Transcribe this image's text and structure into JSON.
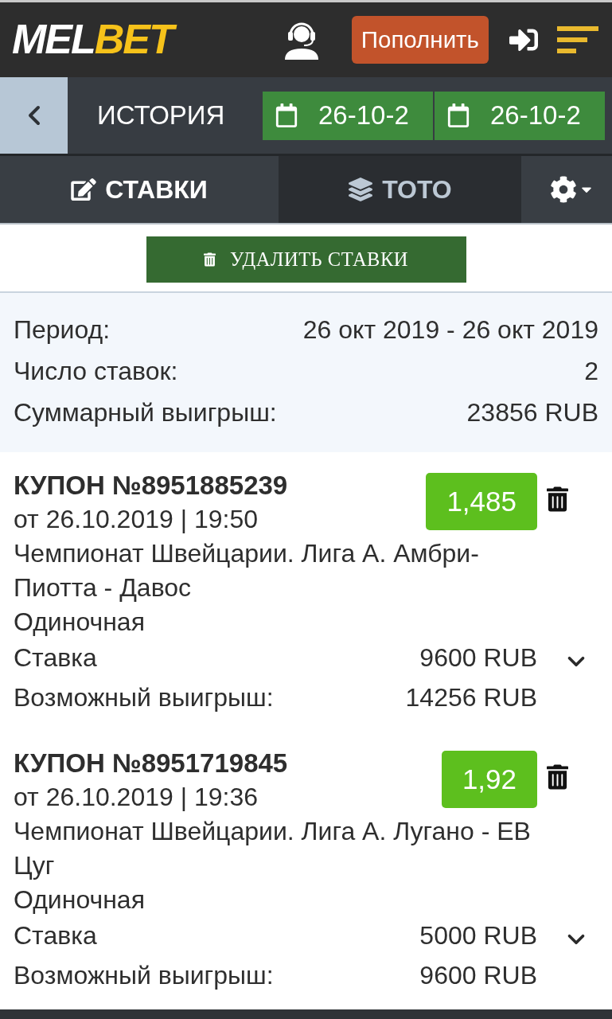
{
  "header": {
    "logo": {
      "text": "MEL",
      "accent": "BET"
    },
    "deposit_button": "Пополнить"
  },
  "subheader": {
    "title": "ИСТОРИЯ",
    "date_fields": [
      {
        "value": "26-10-2"
      },
      {
        "value": "26-10-2"
      }
    ]
  },
  "tabs": [
    {
      "label": "СТАВКИ",
      "selected": true
    },
    {
      "label": "ТОТО",
      "selected": false
    }
  ],
  "delete_button": "УДАЛИТЬ СТАВКИ",
  "summary": [
    {
      "label": "Период:",
      "value": "26 окт 2019 - 26 окт 2019"
    },
    {
      "label": "Число ставок:",
      "value": "2"
    },
    {
      "label": "Суммарный выигрыш:",
      "value": "23856 RUB"
    }
  ],
  "coupons": [
    {
      "title": "КУПОН №8951885239",
      "date": "от 26.10.2019 | 19:50",
      "event": "Чемпионат Швейцарии. Лига А. Амбри-Пиотта - Давос",
      "type": "Одиночная",
      "odds": "1,485",
      "rows": [
        {
          "label": "Ставка",
          "value": "9600 RUB"
        },
        {
          "label": "Возможный выигрыш:",
          "value": "14256 RUB"
        }
      ],
      "expanded": false
    },
    {
      "title": "КУПОН №8951719845",
      "date": "от 26.10.2019 | 19:36",
      "event": "Чемпионат Швейцарии. Лига А. Лугано - ЕВ Цуг",
      "type": "Одиночная",
      "odds": "1,92",
      "rows": [
        {
          "label": "Ставка",
          "value": "5000 RUB"
        },
        {
          "label": "Возможный выигрыш:",
          "value": "9600 RUB"
        }
      ],
      "expanded": false
    }
  ]
}
